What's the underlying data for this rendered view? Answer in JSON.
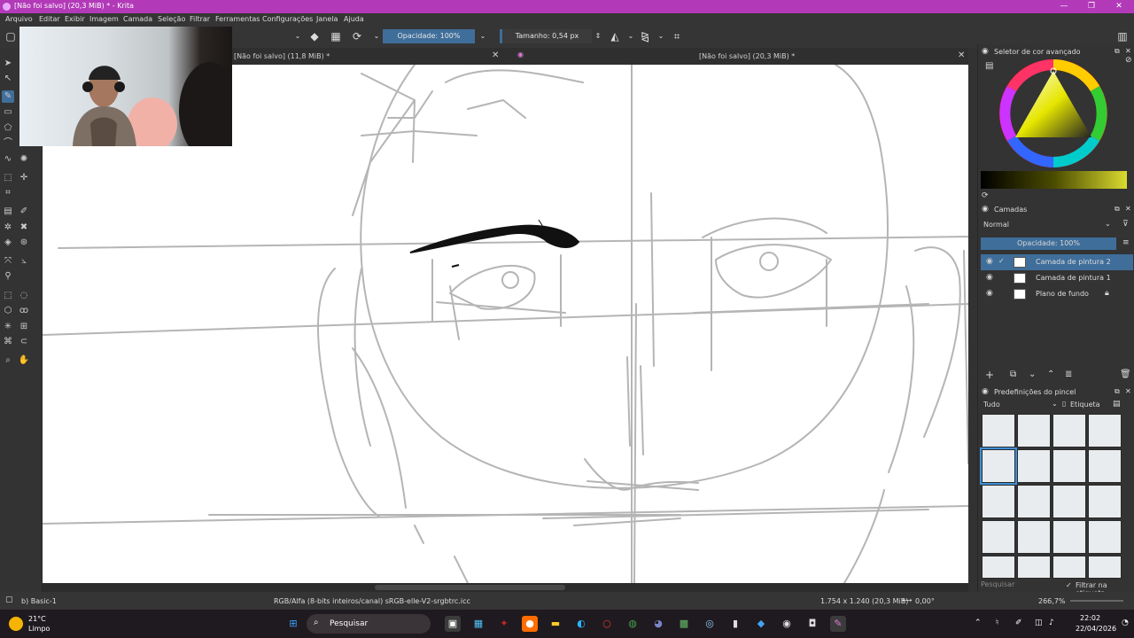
{
  "window": {
    "title": "[Não foi salvo]  (20,3 MiB) * - Krita",
    "controls": {
      "minimize": "—",
      "restore": "❐",
      "close": "✕"
    }
  },
  "menu": [
    "Arquivo",
    "Editar",
    "Exibir",
    "Imagem",
    "Camada",
    "Seleção",
    "Filtrar",
    "Ferramentas",
    "Configurações",
    "Janela",
    "Ajuda"
  ],
  "toolbar": {
    "opacity": "Opacidade: 100%",
    "size": "Tamanho: 0,54 px"
  },
  "tabs": [
    {
      "label": "[Não foi salvo]  (11,8 MiB) *"
    },
    {
      "label": "[Não foi salvo]  (20,3 MiB) *"
    }
  ],
  "color_panel": {
    "title": "Seletor de cor avançado"
  },
  "layers_panel": {
    "title": "Camadas",
    "blend_mode": "Normal",
    "opacity": "Opacidade:  100%",
    "layers": [
      {
        "name": "Camada de pintura 2",
        "selected": true
      },
      {
        "name": "Camada de pintura 1",
        "selected": false
      },
      {
        "name": "Plano de fundo",
        "selected": false
      }
    ]
  },
  "brush_panel": {
    "title": "Predefinições do pincel",
    "filter": "Tudo",
    "tag_label": "Etiqueta",
    "search_placeholder": "Pesquisar",
    "filter_by_tag": "Filtrar na etiqueta"
  },
  "status": {
    "brush": "b) Basic-1",
    "colorspace": "RGB/Alfa (8-bits inteiros/canal)  sRGB-elle-V2-srgbtrc.icc",
    "dimensions": "1.754 x 1.240 (20,3 MiB)",
    "rotation": "0,00°",
    "zoom": "266,7%"
  },
  "taskbar": {
    "weather_temp": "21°C",
    "weather_desc": "Limpo",
    "search": "Pesquisar",
    "time": "22:02",
    "date": "22/04/2026"
  },
  "colors": {
    "titlebar": "#b23ab8",
    "accent": "#3f6e9a",
    "sketch": "#b5b5b5",
    "ink": "#111111"
  }
}
